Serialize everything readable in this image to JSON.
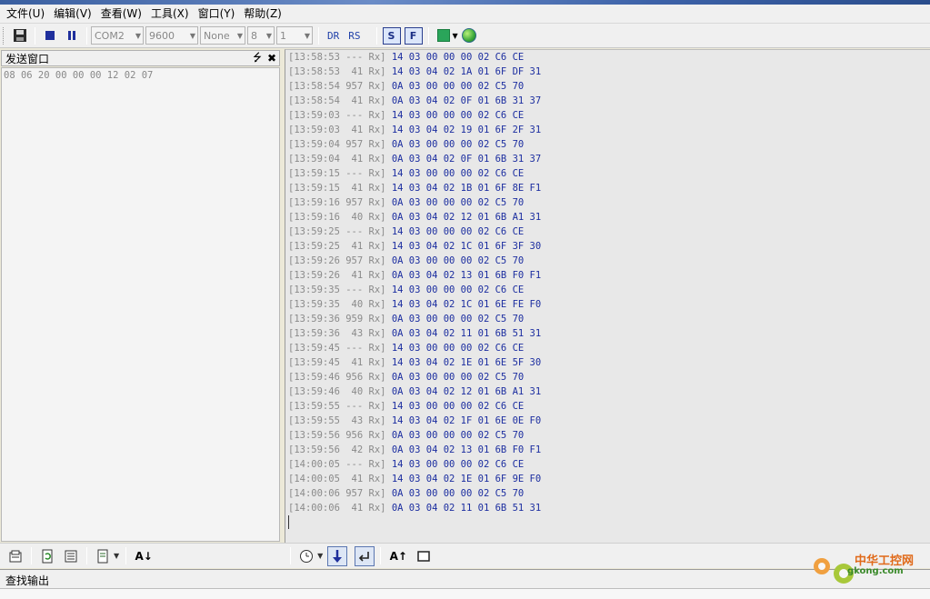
{
  "menu": [
    "文件(U)",
    "编辑(V)",
    "查看(W)",
    "工具(X)",
    "窗口(Y)",
    "帮助(Z)"
  ],
  "toolbar": {
    "port": "COM2",
    "baud": "9600",
    "parity": "None",
    "databits": "8",
    "stopbits": "1",
    "dr": "DR",
    "rs": "RS",
    "s_label": "S",
    "f_label": "F"
  },
  "send_pane": {
    "title": "发送窗口",
    "pin": "⭍",
    "close": "✖",
    "content": "08 06 20 00 00 00 12 02 07"
  },
  "log": [
    {
      "time": "[13:58:53",
      "ms": "---",
      "dir": "Rx]",
      "hex": "14 03 00 00 00 02 C6 CE"
    },
    {
      "time": "[13:58:53",
      "ms": "41",
      "dir": "Rx]",
      "hex": "14 03 04 02 1A 01 6F DF 31"
    },
    {
      "time": "[13:58:54",
      "ms": "957",
      "dir": "Rx]",
      "hex": "0A 03 00 00 00 02 C5 70"
    },
    {
      "time": "[13:58:54",
      "ms": "41",
      "dir": "Rx]",
      "hex": "0A 03 04 02 0F 01 6B 31 37"
    },
    {
      "time": "[13:59:03",
      "ms": "---",
      "dir": "Rx]",
      "hex": "14 03 00 00 00 02 C6 CE"
    },
    {
      "time": "[13:59:03",
      "ms": "41",
      "dir": "Rx]",
      "hex": "14 03 04 02 19 01 6F 2F 31"
    },
    {
      "time": "[13:59:04",
      "ms": "957",
      "dir": "Rx]",
      "hex": "0A 03 00 00 00 02 C5 70"
    },
    {
      "time": "[13:59:04",
      "ms": "41",
      "dir": "Rx]",
      "hex": "0A 03 04 02 0F 01 6B 31 37"
    },
    {
      "time": "[13:59:15",
      "ms": "---",
      "dir": "Rx]",
      "hex": "14 03 00 00 00 02 C6 CE"
    },
    {
      "time": "[13:59:15",
      "ms": "41",
      "dir": "Rx]",
      "hex": "14 03 04 02 1B 01 6F 8E F1"
    },
    {
      "time": "[13:59:16",
      "ms": "957",
      "dir": "Rx]",
      "hex": "0A 03 00 00 00 02 C5 70"
    },
    {
      "time": "[13:59:16",
      "ms": "40",
      "dir": "Rx]",
      "hex": "0A 03 04 02 12 01 6B A1 31"
    },
    {
      "time": "[13:59:25",
      "ms": "---",
      "dir": "Rx]",
      "hex": "14 03 00 00 00 02 C6 CE"
    },
    {
      "time": "[13:59:25",
      "ms": "41",
      "dir": "Rx]",
      "hex": "14 03 04 02 1C 01 6F 3F 30"
    },
    {
      "time": "[13:59:26",
      "ms": "957",
      "dir": "Rx]",
      "hex": "0A 03 00 00 00 02 C5 70"
    },
    {
      "time": "[13:59:26",
      "ms": "41",
      "dir": "Rx]",
      "hex": "0A 03 04 02 13 01 6B F0 F1"
    },
    {
      "time": "[13:59:35",
      "ms": "---",
      "dir": "Rx]",
      "hex": "14 03 00 00 00 02 C6 CE"
    },
    {
      "time": "[13:59:35",
      "ms": "40",
      "dir": "Rx]",
      "hex": "14 03 04 02 1C 01 6E FE F0"
    },
    {
      "time": "[13:59:36",
      "ms": "959",
      "dir": "Rx]",
      "hex": "0A 03 00 00 00 02 C5 70"
    },
    {
      "time": "[13:59:36",
      "ms": "43",
      "dir": "Rx]",
      "hex": "0A 03 04 02 11 01 6B 51 31"
    },
    {
      "time": "[13:59:45",
      "ms": "---",
      "dir": "Rx]",
      "hex": "14 03 00 00 00 02 C6 CE"
    },
    {
      "time": "[13:59:45",
      "ms": "41",
      "dir": "Rx]",
      "hex": "14 03 04 02 1E 01 6E 5F 30"
    },
    {
      "time": "[13:59:46",
      "ms": "956",
      "dir": "Rx]",
      "hex": "0A 03 00 00 00 02 C5 70"
    },
    {
      "time": "[13:59:46",
      "ms": "40",
      "dir": "Rx]",
      "hex": "0A 03 04 02 12 01 6B A1 31"
    },
    {
      "time": "[13:59:55",
      "ms": "---",
      "dir": "Rx]",
      "hex": "14 03 00 00 00 02 C6 CE"
    },
    {
      "time": "[13:59:55",
      "ms": "43",
      "dir": "Rx]",
      "hex": "14 03 04 02 1F 01 6E 0E F0"
    },
    {
      "time": "[13:59:56",
      "ms": "956",
      "dir": "Rx]",
      "hex": "0A 03 00 00 00 02 C5 70"
    },
    {
      "time": "[13:59:56",
      "ms": "42",
      "dir": "Rx]",
      "hex": "0A 03 04 02 13 01 6B F0 F1"
    },
    {
      "time": "[14:00:05",
      "ms": "---",
      "dir": "Rx]",
      "hex": "14 03 00 00 00 02 C6 CE"
    },
    {
      "time": "[14:00:05",
      "ms": "41",
      "dir": "Rx]",
      "hex": "14 03 04 02 1E 01 6F 9E F0"
    },
    {
      "time": "[14:00:06",
      "ms": "957",
      "dir": "Rx]",
      "hex": "0A 03 00 00 00 02 C5 70"
    },
    {
      "time": "[14:00:06",
      "ms": "41",
      "dir": "Rx]",
      "hex": "0A 03 04 02 11 01 6B 51 31"
    }
  ],
  "bottom": {
    "sort_label": "A↓",
    "sort2_label": "A↑"
  },
  "find_panel": {
    "title": "查找输出"
  },
  "watermark": {
    "line1": "中华工控网",
    "line2": "gkong.com"
  },
  "colors": {
    "hex_text": "#1c2ea0",
    "meta_text": "#8a8a8a",
    "accent": "#2a3f8f"
  }
}
